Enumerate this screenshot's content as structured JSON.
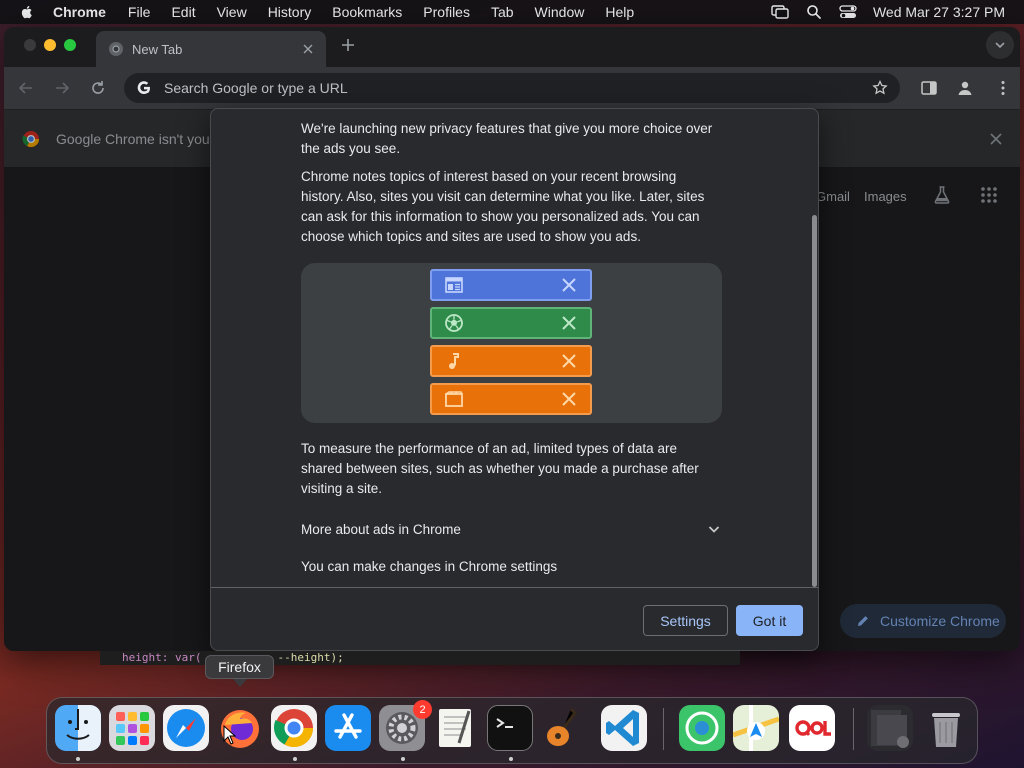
{
  "menubar": {
    "app_name": "Chrome",
    "items": [
      "File",
      "Edit",
      "View",
      "History",
      "Bookmarks",
      "Profiles",
      "Tab",
      "Window",
      "Help"
    ],
    "clock": "Wed Mar 27  3:27 PM"
  },
  "browser": {
    "tab_title": "New Tab",
    "omnibox_placeholder": "Search Google or type a URL",
    "infobar_message": "Google Chrome isn't your",
    "ntp_links": [
      "Gmail",
      "Images"
    ],
    "customize_label": "Customize Chrome"
  },
  "dialog": {
    "para_intro": "We're launching new privacy features that give you more choice over the ads you see.",
    "para_topics": "Chrome notes topics of interest based on your recent browsing history. Also, sites you visit can determine what you like. Later, sites can ask for this information to show you personalized ads. You can choose which topics and sites are used to show you ads.",
    "para_measure": "To measure the performance of an ad, limited types of data are shared between sites, such as whether you made a purchase after visiting a site.",
    "expander_label": "More about ads in Chrome",
    "settings_line": "You can make changes in Chrome settings",
    "settings_button": "Settings",
    "gotit_button": "Got it",
    "topic_colors": {
      "blue_bg": "#4f74d9",
      "blue_fg": "#c6d6ff",
      "green_bg": "#2e8b4a",
      "green_fg": "#bde8c8",
      "orange_bg": "#e8710a",
      "orange_fg": "#ffd8a8"
    }
  },
  "background_code": {
    "prop": "height: var(",
    "value": "--height);"
  },
  "tooltip": "Firefox",
  "dock": {
    "apps": [
      "Finder",
      "Launchpad",
      "Safari",
      "Firefox",
      "Google Chrome",
      "App Store",
      "System Settings",
      "TextEdit",
      "Terminal",
      "GarageBand",
      "Visual Studio Code",
      "Find My",
      "Maps",
      "QQ Browser",
      "Downloads",
      "Trash"
    ],
    "settings_badge": "2"
  }
}
